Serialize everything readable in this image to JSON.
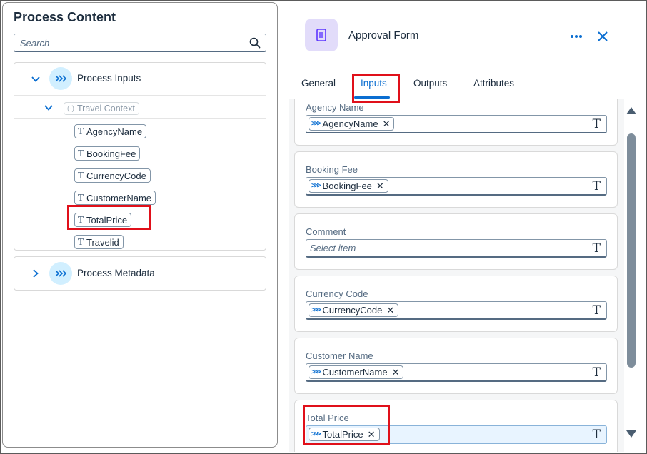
{
  "left": {
    "title": "Process Content",
    "search_placeholder": "Search",
    "process_inputs": "Process Inputs",
    "travel_context": "Travel Context",
    "fields": [
      "AgencyName",
      "BookingFee",
      "CurrencyCode",
      "CustomerName",
      "TotalPrice",
      "Travelid"
    ],
    "process_metadata": "Process Metadata"
  },
  "right": {
    "title": "Approval Form",
    "tabs": [
      "General",
      "Inputs",
      "Outputs",
      "Attributes"
    ],
    "active_tab": "Inputs",
    "cards": [
      {
        "label": "Agency Name",
        "token": "AgencyName"
      },
      {
        "label": "Booking Fee",
        "token": "BookingFee"
      },
      {
        "label": "Comment",
        "placeholder": "Select item"
      },
      {
        "label": "Currency Code",
        "token": "CurrencyCode"
      },
      {
        "label": "Customer Name",
        "token": "CustomerName"
      },
      {
        "label": "Total Price",
        "token": "TotalPrice"
      }
    ]
  },
  "colors": {
    "accent": "#0a6ed1",
    "highlight": "#e0101a",
    "app_icon_bg": "#e2dcfa",
    "node_icon_bg": "#d1efff"
  }
}
